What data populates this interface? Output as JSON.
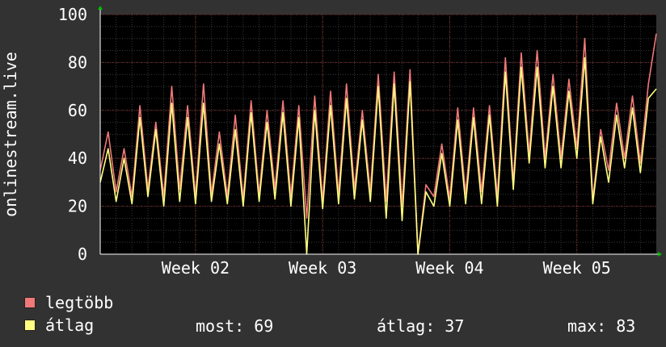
{
  "chart_data": {
    "type": "area",
    "ylabel": "onlinestream.live",
    "ylim": [
      0,
      100
    ],
    "y_ticks": [
      "0",
      "20",
      "40",
      "60",
      "80",
      "100"
    ],
    "x_tick_labels": [
      "Week 02",
      "Week 03",
      "Week 04",
      "Week 05"
    ],
    "x_domain_days": [
      0,
      35
    ],
    "x_tick_positions_days": [
      6,
      14,
      22,
      30
    ],
    "series": [
      {
        "name": "legtöbb",
        "color": "#f07878",
        "x": [
          0,
          0.5,
          1,
          1.5,
          2,
          2.5,
          3,
          3.5,
          4,
          4.5,
          5,
          5.5,
          6,
          6.5,
          7,
          7.5,
          8,
          8.5,
          9,
          9.5,
          10,
          10.5,
          11,
          11.5,
          12,
          12.5,
          13,
          13.5,
          14,
          14.5,
          15,
          15.5,
          16,
          16.5,
          17,
          17.5,
          18,
          18.5,
          19,
          19.5,
          20,
          20.5,
          21,
          21.5,
          22,
          22.5,
          23,
          23.5,
          24,
          24.5,
          25,
          25.5,
          26,
          26.5,
          27,
          27.5,
          28,
          28.5,
          29,
          29.5,
          30,
          30.5,
          31,
          31.5,
          32,
          32.5,
          33,
          33.5,
          34,
          34.5,
          35
        ],
        "values": [
          35,
          51,
          26,
          44,
          24,
          62,
          27,
          55,
          24,
          70,
          27,
          62,
          24,
          71,
          25,
          51,
          24,
          58,
          23,
          64,
          25,
          60,
          27,
          64,
          24,
          62,
          15,
          66,
          22,
          68,
          25,
          71,
          27,
          60,
          26,
          75,
          22,
          76,
          20,
          77,
          0,
          29,
          24,
          46,
          23,
          61,
          25,
          61,
          26,
          62,
          24,
          82,
          30,
          84,
          42,
          85,
          40,
          75,
          40,
          73,
          44,
          90,
          23,
          52,
          35,
          63,
          40,
          66,
          38,
          71,
          92
        ]
      },
      {
        "name": "átlag",
        "color": "#ffff80",
        "x": [
          0,
          0.5,
          1,
          1.5,
          2,
          2.5,
          3,
          3.5,
          4,
          4.5,
          5,
          5.5,
          6,
          6.5,
          7,
          7.5,
          8,
          8.5,
          9,
          9.5,
          10,
          10.5,
          11,
          11.5,
          12,
          12.5,
          13,
          13.5,
          14,
          14.5,
          15,
          15.5,
          16,
          16.5,
          17,
          17.5,
          18,
          18.5,
          19,
          19.5,
          20,
          20.5,
          21,
          21.5,
          22,
          22.5,
          23,
          23.5,
          24,
          24.5,
          25,
          25.5,
          26,
          26.5,
          27,
          27.5,
          28,
          28.5,
          29,
          29.5,
          30,
          30.5,
          31,
          31.5,
          32,
          32.5,
          33,
          33.5,
          34,
          34.5,
          35
        ],
        "values": [
          30,
          44,
          22,
          40,
          21,
          57,
          24,
          52,
          20,
          63,
          22,
          57,
          21,
          63,
          22,
          46,
          21,
          52,
          20,
          59,
          22,
          55,
          23,
          59,
          20,
          57,
          0,
          60,
          19,
          62,
          21,
          65,
          23,
          56,
          22,
          70,
          15,
          71,
          14,
          72,
          0,
          26,
          20,
          42,
          20,
          56,
          21,
          57,
          21,
          58,
          20,
          76,
          27,
          78,
          38,
          78,
          36,
          70,
          36,
          68,
          40,
          82,
          21,
          49,
          30,
          58,
          36,
          61,
          34,
          65,
          69
        ]
      }
    ],
    "legend": [
      {
        "label": "legtöbb",
        "color": "#f07878"
      },
      {
        "label": "átlag",
        "color": "#ffff80"
      }
    ],
    "stats": {
      "most": "most: 69",
      "atlag": "átlag: 37",
      "max": "max: 83"
    },
    "grid": true,
    "colors": {
      "background": "#323232",
      "plot_background": "#000000",
      "grid_minor": "#3a3a3a",
      "grid_major": "#7a2a2a",
      "axis": "#ffffff",
      "arrow": "#00c000"
    }
  }
}
